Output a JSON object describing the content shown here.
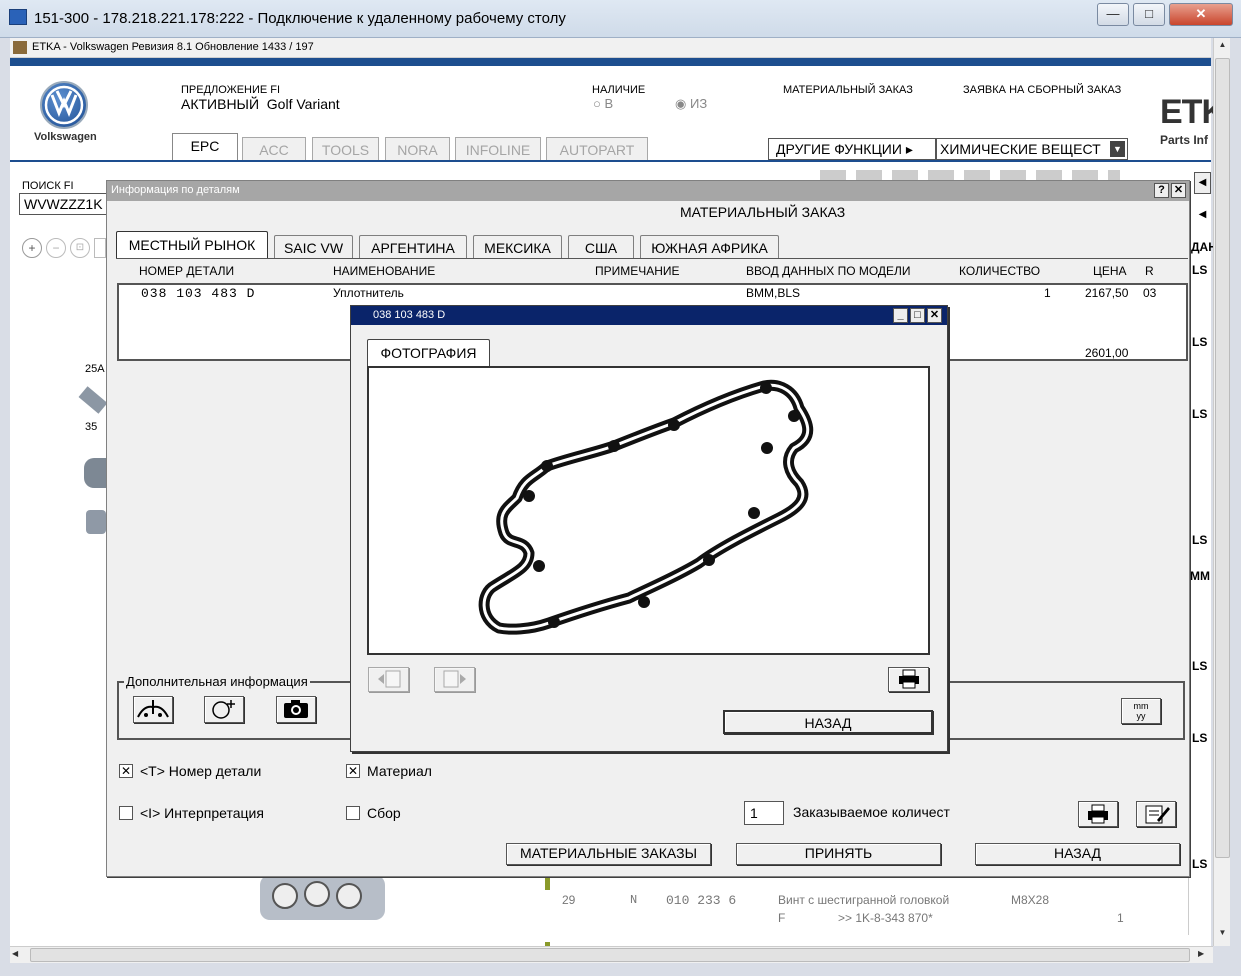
{
  "rdp": {
    "title": "151-300 - 178.218.221.178:222 - Подключение к удаленному рабочему столу",
    "min": "—",
    "max": "□",
    "close": "✕"
  },
  "etka": {
    "title": "ETKA - Volkswagen Ревизия 8.1 Обновление 1433 / 197",
    "brand": "Volkswagen",
    "logo_partial": "ETK",
    "logo_sub": "Parts Inf",
    "proposal_label": "ПРЕДЛОЖЕНИЕ FI",
    "proposal_value": "АКТИВНЫЙ  Golf Variant",
    "availability_label": "НАЛИЧИЕ",
    "avail_opt1": "В",
    "avail_opt2": "ИЗ",
    "material_order": "МАТЕРИАЛЬНЫЙ ЗАКАЗ",
    "assembly_order": "ЗАЯВКА НА СБОРНЫЙ ЗАКАЗ",
    "tabs": [
      "EPC",
      "ACC",
      "TOOLS",
      "NORA",
      "INFOLINE",
      "AUTOPART"
    ],
    "other_functions": "ДРУГИЕ ФУНКЦИИ",
    "select_value": "ХИМИЧЕСКИЕ ВЕЩЕСТ",
    "search_label": "ПОИСК FI",
    "search_value": "WVWZZZ1K"
  },
  "background": {
    "left_labels": [
      "25A",
      "35"
    ],
    "right_col_header": "ДАН",
    "right_col_values": [
      "LS",
      "LS",
      "LS",
      "LS",
      "MM",
      "LS",
      "LS",
      "LS"
    ],
    "bottom_row": {
      "pos": "29",
      "n": "N",
      "part": "010 233 6",
      "desc": "Винт с шестигранной головкой",
      "size": "M8X28",
      "f": "F",
      "ref": ">> 1K-8-343 870*",
      "qty": "1"
    }
  },
  "dialog": {
    "title": "Информация по деталям",
    "help": "?",
    "close": "✕",
    "heading": "МАТЕРИАЛЬНЫЙ ЗАКАЗ",
    "tabs": [
      "МЕСТНЫЙ РЫНОК",
      "SAIC VW",
      "АРГЕНТИНА",
      "МЕКСИКА",
      "США",
      "ЮЖНАЯ АФРИКА"
    ],
    "columns": [
      "НОМЕР ДЕТАЛИ",
      "НАИМЕНОВАНИЕ",
      "ПРИМЕЧАНИЕ",
      "ВВОД ДАННЫХ ПО МОДЕЛИ",
      "КОЛИЧЕСТВО",
      "ЦЕНА",
      "R"
    ],
    "row": {
      "part": "038 103 483 D",
      "name": "Уплотнитель",
      "model": "BMM,BLS",
      "qty": "1",
      "price": "2167,50",
      "r": "03"
    },
    "total": "2601,00",
    "extra_info": "Дополнительная информация",
    "units": "mm/yy",
    "units_top": "mm",
    "units_bottom": "yy",
    "cb_part_number": "<T> Номер детали",
    "cb_interpretation": "<I> Интерпретация",
    "cb_material": "Материал",
    "cb_assembly": "Сбор",
    "order_qty_value": "1",
    "order_qty_label": "Заказываемое количест",
    "btn_material_orders": "МАТЕРИАЛЬНЫЕ ЗАКАЗЫ",
    "btn_accept": "ПРИНЯТЬ",
    "btn_back": "НАЗАД"
  },
  "photo": {
    "title": "038 103 483 D",
    "tab": "ФОТОГРАФИЯ",
    "btn_back": "НАЗАД"
  }
}
